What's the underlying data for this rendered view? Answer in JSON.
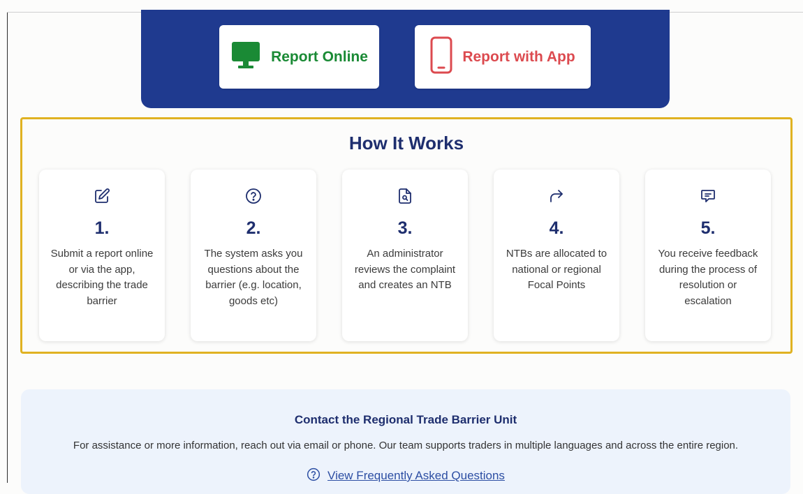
{
  "report_buttons": {
    "online_label": "Report Online",
    "app_label": "Report with App",
    "online_color": "#1a8a35",
    "app_color": "#dc4a4f"
  },
  "how_it_works": {
    "title": "How It Works",
    "steps": [
      {
        "icon": "edit-icon",
        "number": "1.",
        "text": "Submit a report online or via the app, describing the trade barrier"
      },
      {
        "icon": "question-circle-icon",
        "number": "2.",
        "text": "The system asks you questions about the barrier (e.g. location, goods etc)"
      },
      {
        "icon": "document-search-icon",
        "number": "3.",
        "text": "An administrator reviews the complaint and creates an NTB"
      },
      {
        "icon": "forward-arrow-icon",
        "number": "4.",
        "text": "NTBs are allocated to national or regional Focal Points"
      },
      {
        "icon": "message-icon",
        "number": "5.",
        "text": "You receive feedback during the process of resolution or escalation"
      }
    ]
  },
  "contact": {
    "title": "Contact the Regional Trade Barrier Unit",
    "text": "For assistance or more information, reach out via email or phone. Our team supports traders in multiple languages and across the entire region.",
    "faq_link": "View Frequently Asked Questions"
  },
  "colors": {
    "hero_bg": "#1f3a8f",
    "border_accent": "#e0b222",
    "heading": "#1e2e6e",
    "contact_bg": "#edf3fc"
  }
}
